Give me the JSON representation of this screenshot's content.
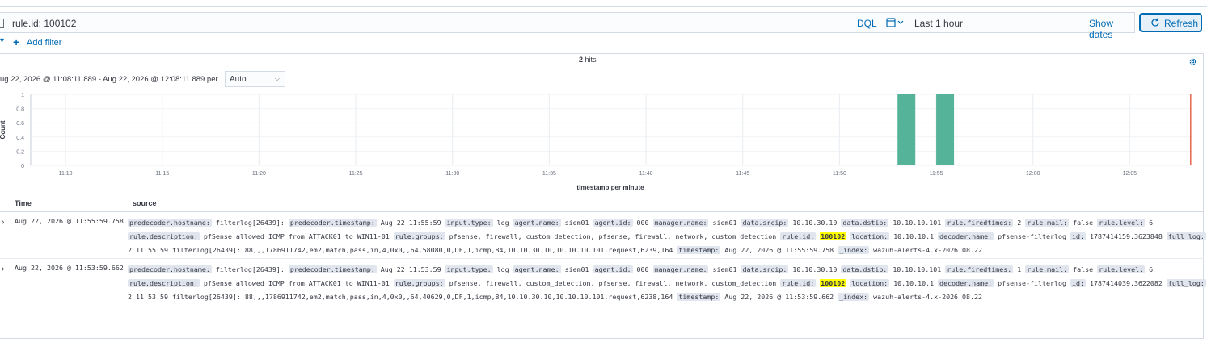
{
  "query": {
    "text": "rule.id: 100102",
    "language_label": "DQL",
    "time_range": "Last 1 hour",
    "show_dates_label": "Show dates",
    "refresh_label": "Refresh",
    "add_filter_label": "Add filter"
  },
  "summary": {
    "hits_count": "2",
    "hits_label": "hits",
    "date_range": "ug 22, 2026 @ 11:08:11.889 - Aug 22, 2026 @ 12:08:11.889 per",
    "interval": "Auto"
  },
  "chart_data": {
    "type": "bar",
    "xlabel": "timestamp per minute",
    "ylabel": "Count",
    "ylim": [
      0,
      1
    ],
    "yticks": [
      "0",
      "0.2",
      "0.4",
      "0.6",
      "0.8",
      "1"
    ],
    "xticks": [
      "11:10",
      "11:15",
      "11:20",
      "11:25",
      "11:30",
      "11:35",
      "11:40",
      "11:45",
      "11:50",
      "11:55",
      "12:00",
      "12:05"
    ],
    "x": [
      "11:53",
      "11:55"
    ],
    "values": [
      1,
      1
    ],
    "bar_color": "#54b399",
    "now_marker": "12:08",
    "now_marker_color": "#e7664c",
    "grid": true
  },
  "table": {
    "columns": [
      "Time",
      "_source"
    ],
    "rows": [
      {
        "time": "Aug 22, 2026 @ 11:55:59.758",
        "lines": [
          [
            {
              "k": "predecoder.hostname:",
              "v": "filterlog[26439]:"
            },
            {
              "k": "predecoder.timestamp:",
              "v": "Aug 22 11:55:59"
            },
            {
              "k": "input.type:",
              "v": "log"
            },
            {
              "k": "agent.name:",
              "v": "siem01"
            },
            {
              "k": "agent.id:",
              "v": "000"
            },
            {
              "k": "manager.name:",
              "v": "siem01"
            },
            {
              "k": "data.srcip:",
              "v": "10.10.30.10"
            },
            {
              "k": "data.dstip:",
              "v": "10.10.10.101"
            },
            {
              "k": "rule.firedtimes:",
              "v": "2"
            },
            {
              "k": "rule.mail:",
              "v": "false"
            },
            {
              "k": "rule.level:",
              "v": "6"
            }
          ],
          [
            {
              "k": "rule.description:",
              "v": "pfSense allowed ICMP from ATTACK01 to WIN11-01"
            },
            {
              "k": "rule.groups:",
              "v": "pfsense, firewall, custom_detection, pfsense, firewall, network, custom_detection"
            },
            {
              "k": "rule.id:",
              "v": "100102",
              "hl": true
            },
            {
              "k": "location:",
              "v": "10.10.10.1"
            },
            {
              "k": "decoder.name:",
              "v": "pfsense-filterlog"
            },
            {
              "k": "id:",
              "v": "1787414159.3623848"
            },
            {
              "k": "full_log:",
              "v": "Aug 2"
            }
          ],
          [
            {
              "v": "2 11:55:59 filterlog[26439]: 88,,,1786911742,em2,match,pass,in,4,0x0,,64,58080,0,DF,1,icmp,84,10.10.30.10,10.10.10.101,request,6239,164"
            },
            {
              "k": "timestamp:",
              "v": "Aug 22, 2026 @ 11:55:59.758"
            },
            {
              "k": "_index:",
              "v": "wazuh-alerts-4.x-2026.08.22"
            }
          ]
        ]
      },
      {
        "time": "Aug 22, 2026 @ 11:53:59.662",
        "lines": [
          [
            {
              "k": "predecoder.hostname:",
              "v": "filterlog[26439]:"
            },
            {
              "k": "predecoder.timestamp:",
              "v": "Aug 22 11:53:59"
            },
            {
              "k": "input.type:",
              "v": "log"
            },
            {
              "k": "agent.name:",
              "v": "siem01"
            },
            {
              "k": "agent.id:",
              "v": "000"
            },
            {
              "k": "manager.name:",
              "v": "siem01"
            },
            {
              "k": "data.srcip:",
              "v": "10.10.30.10"
            },
            {
              "k": "data.dstip:",
              "v": "10.10.10.101"
            },
            {
              "k": "rule.firedtimes:",
              "v": "1"
            },
            {
              "k": "rule.mail:",
              "v": "false"
            },
            {
              "k": "rule.level:",
              "v": "6"
            }
          ],
          [
            {
              "k": "rule.description:",
              "v": "pfSense allowed ICMP from ATTACK01 to WIN11-01"
            },
            {
              "k": "rule.groups:",
              "v": "pfsense, firewall, custom_detection, pfsense, firewall, network, custom_detection"
            },
            {
              "k": "rule.id:",
              "v": "100102",
              "hl": true
            },
            {
              "k": "location:",
              "v": "10.10.10.1"
            },
            {
              "k": "decoder.name:",
              "v": "pfsense-filterlog"
            },
            {
              "k": "id:",
              "v": "1787414039.3622082"
            },
            {
              "k": "full_log:",
              "v": "Aug 2"
            }
          ],
          [
            {
              "v": "2 11:53:59 filterlog[26439]: 88,,,1786911742,em2,match,pass,in,4,0x0,,64,40629,0,DF,1,icmp,84,10.10.30.10,10.10.10.101,request,6238,164"
            },
            {
              "k": "timestamp:",
              "v": "Aug 22, 2026 @ 11:53:59.662"
            },
            {
              "k": "_index:",
              "v": "wazuh-alerts-4.x-2026.08.22"
            }
          ]
        ]
      }
    ]
  }
}
